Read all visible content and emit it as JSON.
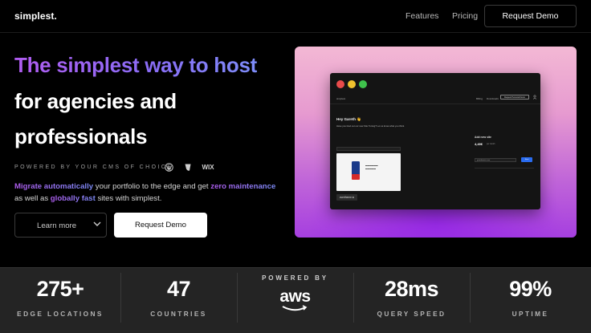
{
  "nav": {
    "logo": "simplest.",
    "links": [
      "Features",
      "Pricing"
    ],
    "cta": "Request Demo"
  },
  "hero": {
    "headline_gradient": "The simplest way to host",
    "headline_line2": "for agencies and",
    "headline_line3": "professionals",
    "powered_by": "POWERED BY YOUR CMS OF CHOICE",
    "cms_icons": [
      "wordpress-icon",
      "typo3-icon",
      "wix-icon"
    ],
    "cms_wix_label": "WIX",
    "desc": {
      "hl1": "Migrate automatically",
      "t1": " your portfolio to the edge and get ",
      "hl2": "zero maintenance",
      "t2": " as well as ",
      "hl3": "globally fast",
      "t3": " sites with simplest."
    },
    "learn_more": "Learn more",
    "request_demo": "Request Demo"
  },
  "preview": {
    "logo": "simplest.",
    "menu": [
      "Billing",
      "Downloads"
    ],
    "demo_button": "Request Personal Demo",
    "greeting": "Hey Gareth 👋",
    "greeting_sub": "Have you tried out our new Site Tuning? Let us know what you think.",
    "chip": "overtheme.io",
    "side_title": "Add new site",
    "side_price": "4,49€",
    "side_price_suffix": "per month",
    "side_input": "yourdomain.com",
    "side_button": "Start"
  },
  "stats": {
    "items": [
      {
        "value": "275+",
        "label": "EDGE LOCATIONS"
      },
      {
        "value": "47",
        "label": "COUNTRIES"
      },
      {
        "value": "28ms",
        "label": "QUERY SPEED"
      },
      {
        "value": "99%",
        "label": "UPTIME"
      }
    ],
    "powered_by": "POWERED BY",
    "aws": "aws"
  },
  "colors": {
    "gradient_start": "#b05cf0",
    "gradient_end": "#7d8cf8",
    "background": "#000000",
    "stats_bg": "#242424"
  }
}
